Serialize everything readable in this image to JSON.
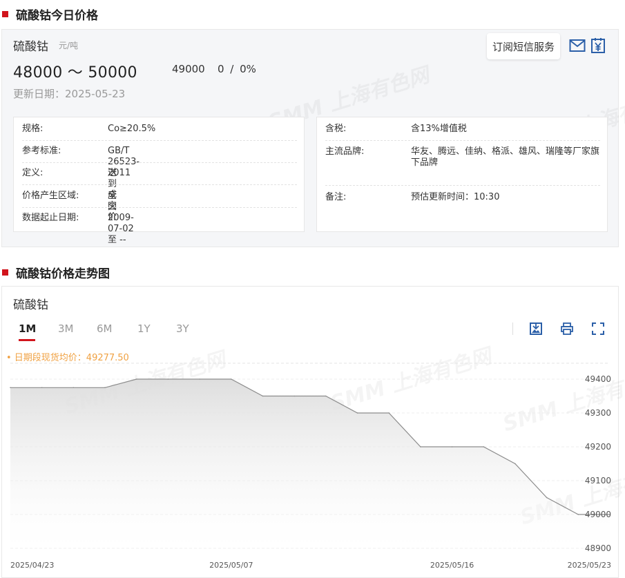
{
  "section1": {
    "title": "硫酸钴今日价格"
  },
  "product": {
    "name": "硫酸钴",
    "unit": "元/吨",
    "price_range": "48000 ～ 50000",
    "avg": "49000",
    "change": "0 / 0%",
    "update_date": "更新日期：2025-05-23"
  },
  "actions": {
    "subscribe_label": "订阅短信服务",
    "mail_icon": "mail-icon",
    "yen_icon": "yen-calendar-icon"
  },
  "info_left": [
    {
      "label": "规格:",
      "value": "Co≥20.5%"
    },
    {
      "label": "参考标准:",
      "value": "GB/T 26523-2011"
    },
    {
      "label": "定义:",
      "value": "送到成交价"
    },
    {
      "label": "价格产生区域:",
      "value": "全国"
    },
    {
      "label": "数据起止日期:",
      "value": "2009-07-02 至 --"
    }
  ],
  "info_right": [
    {
      "label": "含税:",
      "value": "含13%增值税"
    },
    {
      "label": "主流品牌:",
      "value": "华友、腾远、佳纳、格派、雄风、瑞隆等厂家旗下品牌"
    },
    {
      "label": "备注:",
      "value": "预估更新时间：10:30"
    }
  ],
  "watermark": {
    "text": "SMM 上海有色网"
  },
  "section2": {
    "title": "硫酸钴价格走势图"
  },
  "chart_panel": {
    "name": "硫酸钴",
    "tabs": [
      "1M",
      "3M",
      "6M",
      "1Y",
      "3Y"
    ],
    "active_tab": "1M",
    "tools": [
      "download-image-icon",
      "print-icon",
      "fullscreen-icon"
    ],
    "avg_label": "• 日期段现货均价：49277.50"
  },
  "colors": {
    "brand_red": "#d1141c",
    "avg_orange": "#f0a142",
    "line": "#8c8c8c"
  },
  "chart_data": {
    "type": "area",
    "title": "",
    "xlabel": "",
    "ylabel": "",
    "ylim": [
      48900,
      49400
    ],
    "y_ticks": [
      "49400",
      "49300",
      "49200",
      "49100",
      "49000",
      "48900"
    ],
    "x_tick_labels": [
      "2025/04/23",
      "2025/05/07",
      "2025/05/16",
      "2025/05/23"
    ],
    "x": [
      "2025/04/23",
      "2025/04/24",
      "2025/04/25",
      "2025/04/28",
      "2025/04/29",
      "2025/04/30",
      "2025/05/06",
      "2025/05/07",
      "2025/05/08",
      "2025/05/09",
      "2025/05/12",
      "2025/05/13",
      "2025/05/14",
      "2025/05/15",
      "2025/05/16",
      "2025/05/19",
      "2025/05/20",
      "2025/05/21",
      "2025/05/22",
      "2025/05/23"
    ],
    "series": [
      {
        "values": [
          49375,
          49375,
          49375,
          49375,
          49400,
          49400,
          49400,
          49400,
          49350,
          49350,
          49350,
          49300,
          49300,
          49200,
          49200,
          49200,
          49150,
          49050,
          49000,
          49000
        ]
      }
    ],
    "grid": true,
    "legend": "none"
  }
}
